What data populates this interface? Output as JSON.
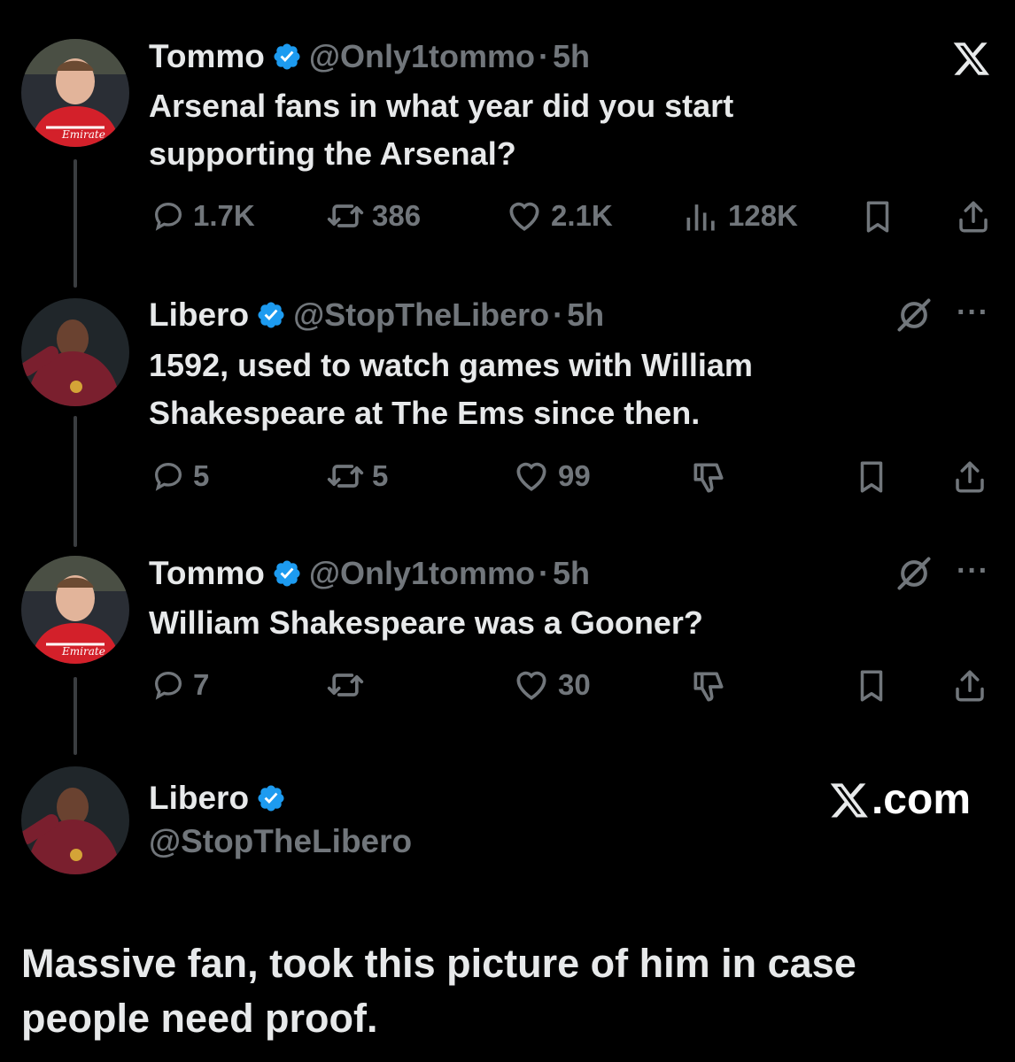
{
  "colors": {
    "background": "#000000",
    "text": "#e7e9ea",
    "muted": "#71767b",
    "verified": "#1d9bf0"
  },
  "tweets": [
    {
      "name": "Tommo",
      "handle": "@Only1tommo",
      "dot": "·",
      "time": "5h",
      "text": "Arsenal fans in what year did you start supporting the Arsenal?",
      "replies": "1.7K",
      "retweets": "386",
      "likes": "2.1K",
      "views": "128K"
    },
    {
      "name": "Libero",
      "handle": "@StopTheLibero",
      "dot": "·",
      "time": "5h",
      "text": "1592, used to watch games with William Shakespeare at The Ems since then.",
      "replies": "5",
      "retweets": "5",
      "likes": "99"
    },
    {
      "name": "Tommo",
      "handle": "@Only1tommo",
      "dot": "·",
      "time": "5h",
      "text": "William Shakespeare was a Gooner?",
      "replies": "7",
      "retweets": "",
      "likes": "30"
    }
  ],
  "final_tweet": {
    "name": "Libero",
    "handle": "@StopTheLibero",
    "brand": ".com"
  },
  "caption": "Massive fan, took this picture of him in case people need proof.",
  "icons": {
    "reply": "reply-icon",
    "retweet": "retweet-icon",
    "like": "heart-icon",
    "views": "views-icon",
    "bookmark": "bookmark-icon",
    "share": "share-icon",
    "dislike": "thumbs-down-icon",
    "grok": "slash-circle-icon",
    "more": "more-icon",
    "x": "x-logo-icon"
  }
}
